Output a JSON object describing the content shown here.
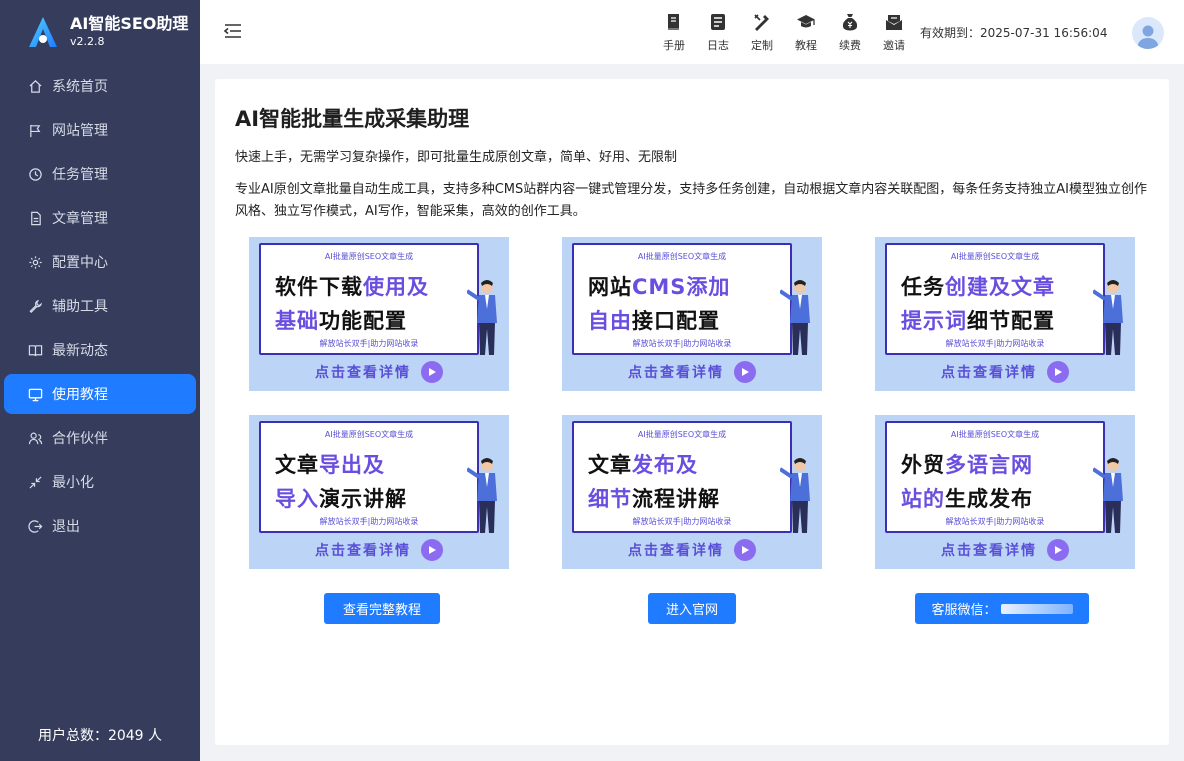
{
  "app": {
    "name": "AI智能SEO助理",
    "version": "v2.2.8"
  },
  "sidebar": {
    "items": [
      {
        "label": "系统首页",
        "icon": "home-icon"
      },
      {
        "label": "网站管理",
        "icon": "flag-icon"
      },
      {
        "label": "任务管理",
        "icon": "clock-icon"
      },
      {
        "label": "文章管理",
        "icon": "document-icon"
      },
      {
        "label": "配置中心",
        "icon": "gear-icon"
      },
      {
        "label": "辅助工具",
        "icon": "wrench-icon"
      },
      {
        "label": "最新动态",
        "icon": "book-icon"
      },
      {
        "label": "使用教程",
        "icon": "monitor-icon",
        "active": true
      },
      {
        "label": "合作伙伴",
        "icon": "users-icon"
      },
      {
        "label": "最小化",
        "icon": "shrink-icon"
      },
      {
        "label": "退出",
        "icon": "logout-icon"
      }
    ],
    "user_total": "用户总数：2049 人"
  },
  "topbar": {
    "tools": [
      {
        "label": "手册",
        "icon": "manual-icon"
      },
      {
        "label": "日志",
        "icon": "log-icon"
      },
      {
        "label": "定制",
        "icon": "customize-icon"
      },
      {
        "label": "教程",
        "icon": "graduation-cap-icon"
      },
      {
        "label": "续费",
        "icon": "money-bag-icon"
      },
      {
        "label": "邀请",
        "icon": "invite-mail-icon"
      }
    ],
    "expiry": "有效期到：2025-07-31 16:56:04"
  },
  "main": {
    "title": "AI智能批量生成采集助理",
    "subtitle": "快速上手，无需学习复杂操作，即可批量生成原创文章，简单、好用、无限制",
    "description": "专业AI原创文章批量自动生成工具，支持多种CMS站群内容一键式管理分发，支持多任务创建，自动根据文章内容关联配图，每条任务支持独立AI模型独立创作风格、独立写作模式，AI写作，智能采集，高效的创作工具。",
    "tutorials": [
      {
        "tag": "AI批量原创SEO文章生成",
        "l1_plain": "软件下载",
        "l1_hl": "使用及",
        "l2_hl": "基础",
        "l2_plain": "功能配置",
        "slogan": "解放站长双手|助力网站收录",
        "cta": "点击查看详情"
      },
      {
        "tag": "AI批量原创SEO文章生成",
        "l1_plain": "网站",
        "l1_hl": "CMS添加",
        "l2_hl": "自由",
        "l2_plain": "接口配置",
        "slogan": "解放站长双手|助力网站收录",
        "cta": "点击查看详情"
      },
      {
        "tag": "AI批量原创SEO文章生成",
        "l1_plain": "任务",
        "l1_hl": "创建及文章",
        "l2_hl": "提示词",
        "l2_plain": "细节配置",
        "slogan": "解放站长双手|助力网站收录",
        "cta": "点击查看详情"
      },
      {
        "tag": "AI批量原创SEO文章生成",
        "l1_plain": "文章",
        "l1_hl": "导出及",
        "l2_hl": "导入",
        "l2_plain": "演示讲解",
        "slogan": "解放站长双手|助力网站收录",
        "cta": "点击查看详情"
      },
      {
        "tag": "AI批量原创SEO文章生成",
        "l1_plain": "文章",
        "l1_hl": "发布及",
        "l2_hl": "细节",
        "l2_plain": "流程讲解",
        "slogan": "解放站长双手|助力网站收录",
        "cta": "点击查看详情"
      },
      {
        "tag": "AI批量原创SEO文章生成",
        "l1_plain": "外贸",
        "l1_hl": "多语言网",
        "l2_hl": "站的",
        "l2_plain": "生成发布",
        "slogan": "解放站长双手|助力网站收录",
        "cta": "点击查看详情"
      }
    ],
    "buttons": {
      "full_tutorial": "查看完整教程",
      "official_site": "进入官网",
      "wechat": "客服微信："
    }
  },
  "colors": {
    "sidebar_bg": "#353c5c",
    "accent": "#1f7bff",
    "highlight": "#6a4ee0"
  }
}
